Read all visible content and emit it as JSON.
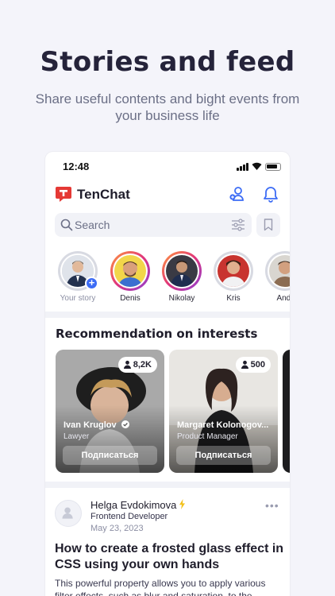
{
  "hero": {
    "title": "Stories and feed",
    "subtitle": "Share useful contents and bight events from your business life"
  },
  "status_bar": {
    "time": "12:48"
  },
  "app": {
    "brand": "TenChat",
    "icons": [
      "add-contact-icon",
      "bell-icon"
    ],
    "accent": "#e53935"
  },
  "search": {
    "placeholder": "Search"
  },
  "stories": [
    {
      "name": "Your story",
      "seen": true,
      "own": true
    },
    {
      "name": "Denis",
      "seen": false
    },
    {
      "name": "Nikolay",
      "seen": false
    },
    {
      "name": "Kris",
      "seen": true
    },
    {
      "name": "Andr",
      "seen": true
    }
  ],
  "recommendations": {
    "title": "Recommendation on interests",
    "cards": [
      {
        "name": "Ivan Kruglov",
        "verified": true,
        "role": "Lawyer",
        "followers": "8,2K",
        "button": "Подписаться"
      },
      {
        "name": "Margaret Kolonogov...",
        "verified": false,
        "role": "Product Manager",
        "followers": "500",
        "button": "Подписаться"
      }
    ]
  },
  "post": {
    "author": "Helga Evdokimova",
    "role": "Frontend Developer",
    "date": "May 23, 2023",
    "title": "How to create a frosted glass effect in CSS using your own hands",
    "body": "This powerful property allows you to apply various filter effects, such as blur and saturation, to the"
  },
  "colors": {
    "primary": "#3c6cf5",
    "brand_red": "#e53935"
  }
}
